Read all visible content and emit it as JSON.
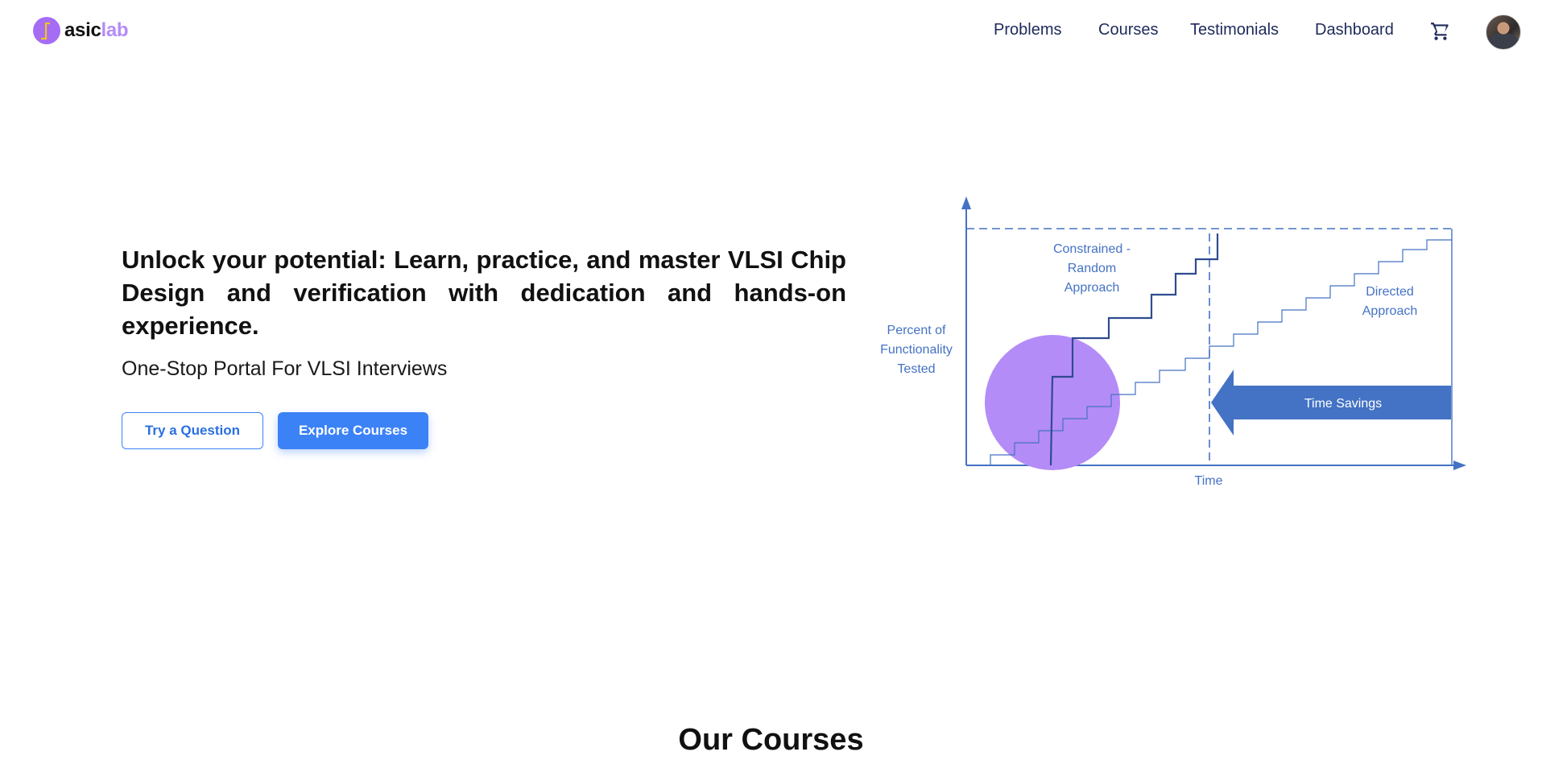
{
  "brand": {
    "name_part1": "asic",
    "name_part2": "lab",
    "colors": {
      "primary": "#3b82f6",
      "logo_purple": "#a56cf4",
      "logo_accent": "#f5c518",
      "diagram_blue": "#4472c4",
      "circle_purple": "#b48cf7",
      "nav_text": "#1e2a5a"
    }
  },
  "nav": {
    "items": [
      {
        "label": "Problems"
      },
      {
        "label": "Courses"
      },
      {
        "label": "Testimonials"
      },
      {
        "label": "Dashboard"
      }
    ],
    "cart_icon": "cart-icon",
    "avatar_icon": "user-avatar"
  },
  "hero": {
    "title": "Unlock your potential: Learn, practice, and master VLSI Chip Design and verification with dedication and hands-on experience.",
    "subtitle": "One-Stop Portal For VLSI Interviews",
    "buttons": {
      "try_question": "Try a Question",
      "explore_courses": "Explore Courses"
    }
  },
  "diagram": {
    "y_label": [
      "Percent of",
      "Functionality",
      "Tested"
    ],
    "x_label": "Time",
    "constrained_label": [
      "Constrained -",
      "Random",
      "Approach"
    ],
    "directed_label": [
      "Directed",
      "Approach"
    ],
    "arrow_label": "Time Savings"
  },
  "courses": {
    "heading": "Our Courses"
  }
}
